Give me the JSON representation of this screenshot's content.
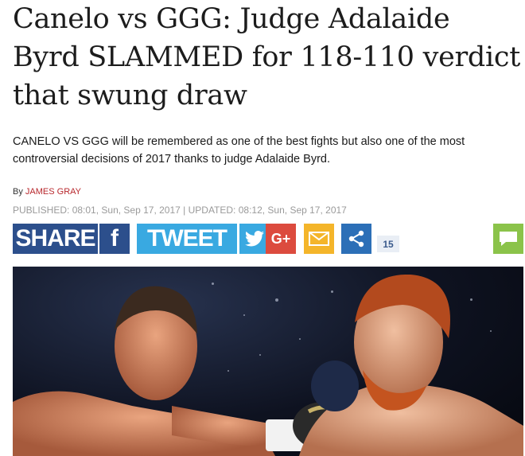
{
  "article": {
    "headline": "Canelo vs GGG: Judge Adalaide Byrd SLAMMED for 118-110 verdict that swung draw",
    "standfirst": "CANELO VS GGG will be remembered as one of the best fights but also one of the most controversial decisions of 2017 thanks to judge Adalaide Byrd.",
    "byline_prefix": "By",
    "author": "JAMES GRAY",
    "published": "PUBLISHED: 08:01, Sun, Sep 17, 2017",
    "separator": " | ",
    "updated": "UPDATED: 08:12, Sun, Sep 17, 2017"
  },
  "share_bar": {
    "share_label": "SHARE",
    "facebook_glyph": "f",
    "tweet_label": "TWEET",
    "googleplus_glyph": "G+",
    "share_count": "15",
    "icons": [
      "facebook-icon",
      "twitter-icon",
      "google-plus-icon",
      "email-icon",
      "share-icon",
      "comments-icon"
    ],
    "colors": {
      "facebook": "#2c4f8c",
      "twitter": "#39a9e1",
      "googleplus": "#dc4b3e",
      "email": "#f4b52a",
      "share": "#2c6fb7",
      "comments": "#8bc34a"
    }
  },
  "colors": {
    "author": "#b8282d",
    "timestamp": "#9a9a9a",
    "headline": "#1c1c1c"
  },
  "image": {
    "subject": "boxing-match-photo"
  }
}
